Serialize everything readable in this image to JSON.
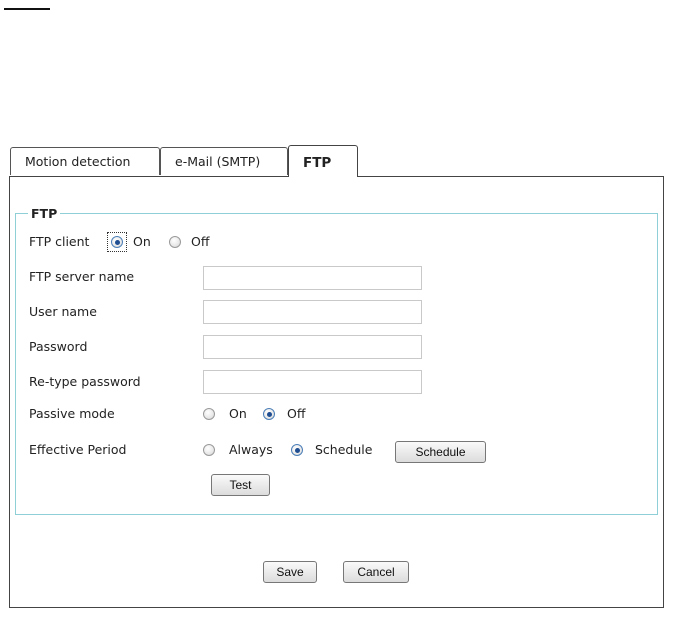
{
  "tabs": [
    {
      "label": "Motion detection"
    },
    {
      "label": "e-Mail (SMTP)"
    },
    {
      "label": "FTP",
      "active": true
    }
  ],
  "ftp": {
    "legend": "FTP",
    "client": {
      "label": "FTP client",
      "on_label": "On",
      "off_label": "Off",
      "selected": "On"
    },
    "server_name": {
      "label": "FTP server name",
      "value": ""
    },
    "user_name": {
      "label": "User name",
      "value": ""
    },
    "password": {
      "label": "Password",
      "value": ""
    },
    "retype_password": {
      "label": "Re-type password",
      "value": ""
    },
    "passive_mode": {
      "label": "Passive mode",
      "on_label": "On",
      "off_label": "Off",
      "selected": "Off"
    },
    "effective_period": {
      "label": "Effective Period",
      "always_label": "Always",
      "schedule_label": "Schedule",
      "selected": "Schedule",
      "schedule_button": "Schedule"
    },
    "test_button": "Test"
  },
  "footer": {
    "save_label": "Save",
    "cancel_label": "Cancel"
  },
  "colors": {
    "fieldset_border": "#8fcfd6",
    "radio_dot": "#1e4d91"
  }
}
